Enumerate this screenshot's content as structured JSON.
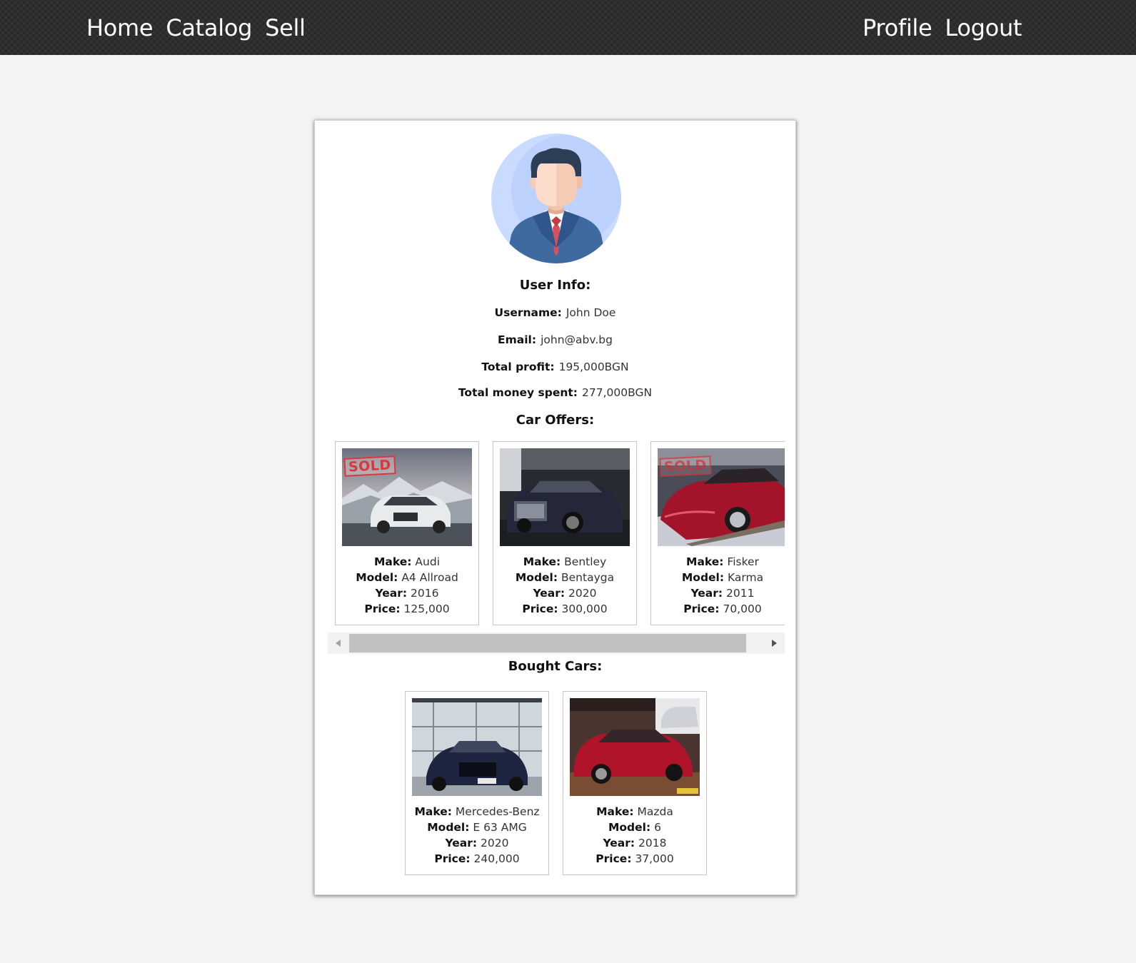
{
  "nav": {
    "left": [
      "Home",
      "Catalog",
      "Sell"
    ],
    "right": [
      "Profile",
      "Logout"
    ]
  },
  "user_info": {
    "heading": "User Info:",
    "fields": [
      {
        "label": "Username:",
        "value": "John Doe"
      },
      {
        "label": "Email:",
        "value": "john@abv.bg"
      },
      {
        "label": "Total profit:",
        "value": "195,000BGN"
      },
      {
        "label": "Total money spent:",
        "value": "277,000BGN"
      }
    ]
  },
  "offers": {
    "heading": "Car Offers:",
    "cars": [
      {
        "make": "Audi",
        "model": "A4 Allroad",
        "year": "2016",
        "price": "125,000",
        "sold": true,
        "badge": "SOLD"
      },
      {
        "make": "Bentley",
        "model": "Bentayga",
        "year": "2020",
        "price": "300,000",
        "sold": false
      },
      {
        "make": "Fisker",
        "model": "Karma",
        "year": "2011",
        "price": "70,000",
        "sold": true,
        "badge": "SOLD"
      }
    ]
  },
  "bought": {
    "heading": "Bought Cars:",
    "cars": [
      {
        "make": "Mercedes-Benz",
        "model": "E 63 AMG",
        "year": "2020",
        "price": "240,000"
      },
      {
        "make": "Mazda",
        "model": "6",
        "year": "2018",
        "price": "37,000"
      }
    ]
  },
  "labels": {
    "make": "Make:",
    "model": "Model:",
    "year": "Year:",
    "price": "Price:"
  },
  "colors": {
    "navbar": "#2e2e2e",
    "background": "#f3f3f3",
    "card": "#ffffff",
    "avatar_bg": "#c9dcff",
    "sold_badge": "#d9363e"
  }
}
